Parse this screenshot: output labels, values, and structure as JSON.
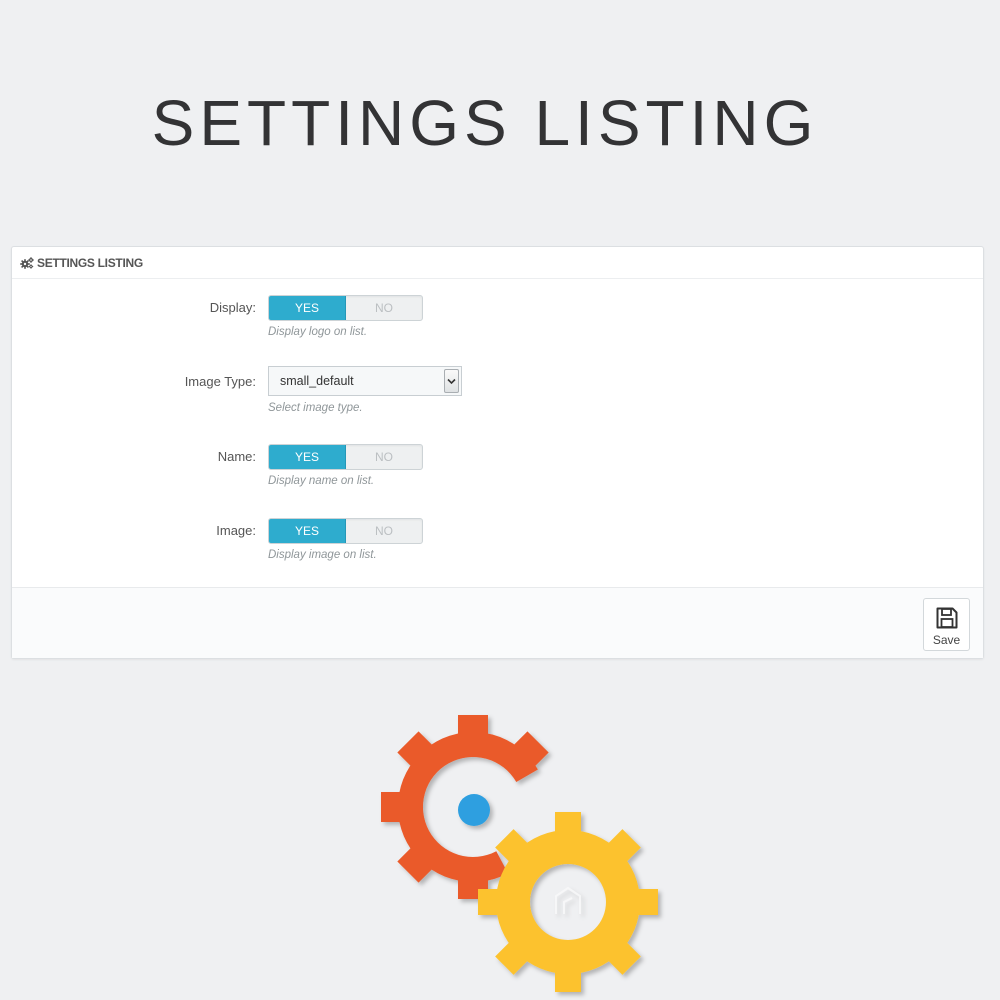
{
  "hero": {
    "title": "SETTINGS LISTING"
  },
  "panel": {
    "heading": "SETTINGS LISTING",
    "heading_icon": "cogs-icon",
    "fields": {
      "display": {
        "label": "Display:",
        "yes": "YES",
        "no": "NO",
        "value": "YES",
        "help": "Display logo on list."
      },
      "image_type": {
        "label": "Image Type:",
        "value": "small_default",
        "help": "Select image type."
      },
      "name": {
        "label": "Name:",
        "yes": "YES",
        "no": "NO",
        "value": "YES",
        "help": "Display name on list."
      },
      "image": {
        "label": "Image:",
        "yes": "YES",
        "no": "NO",
        "value": "YES",
        "help": "Display image on list."
      }
    },
    "footer": {
      "save_label": "Save",
      "save_icon": "floppy-disk-icon"
    }
  },
  "colors": {
    "page_bg": "#eff0f2",
    "switch_on": "#2eacce",
    "gear_orange": "#ea5a2a",
    "gear_yellow": "#fcc22e",
    "dot_blue": "#2e9fe0"
  },
  "illustration": {
    "icon": "gears-icon"
  }
}
